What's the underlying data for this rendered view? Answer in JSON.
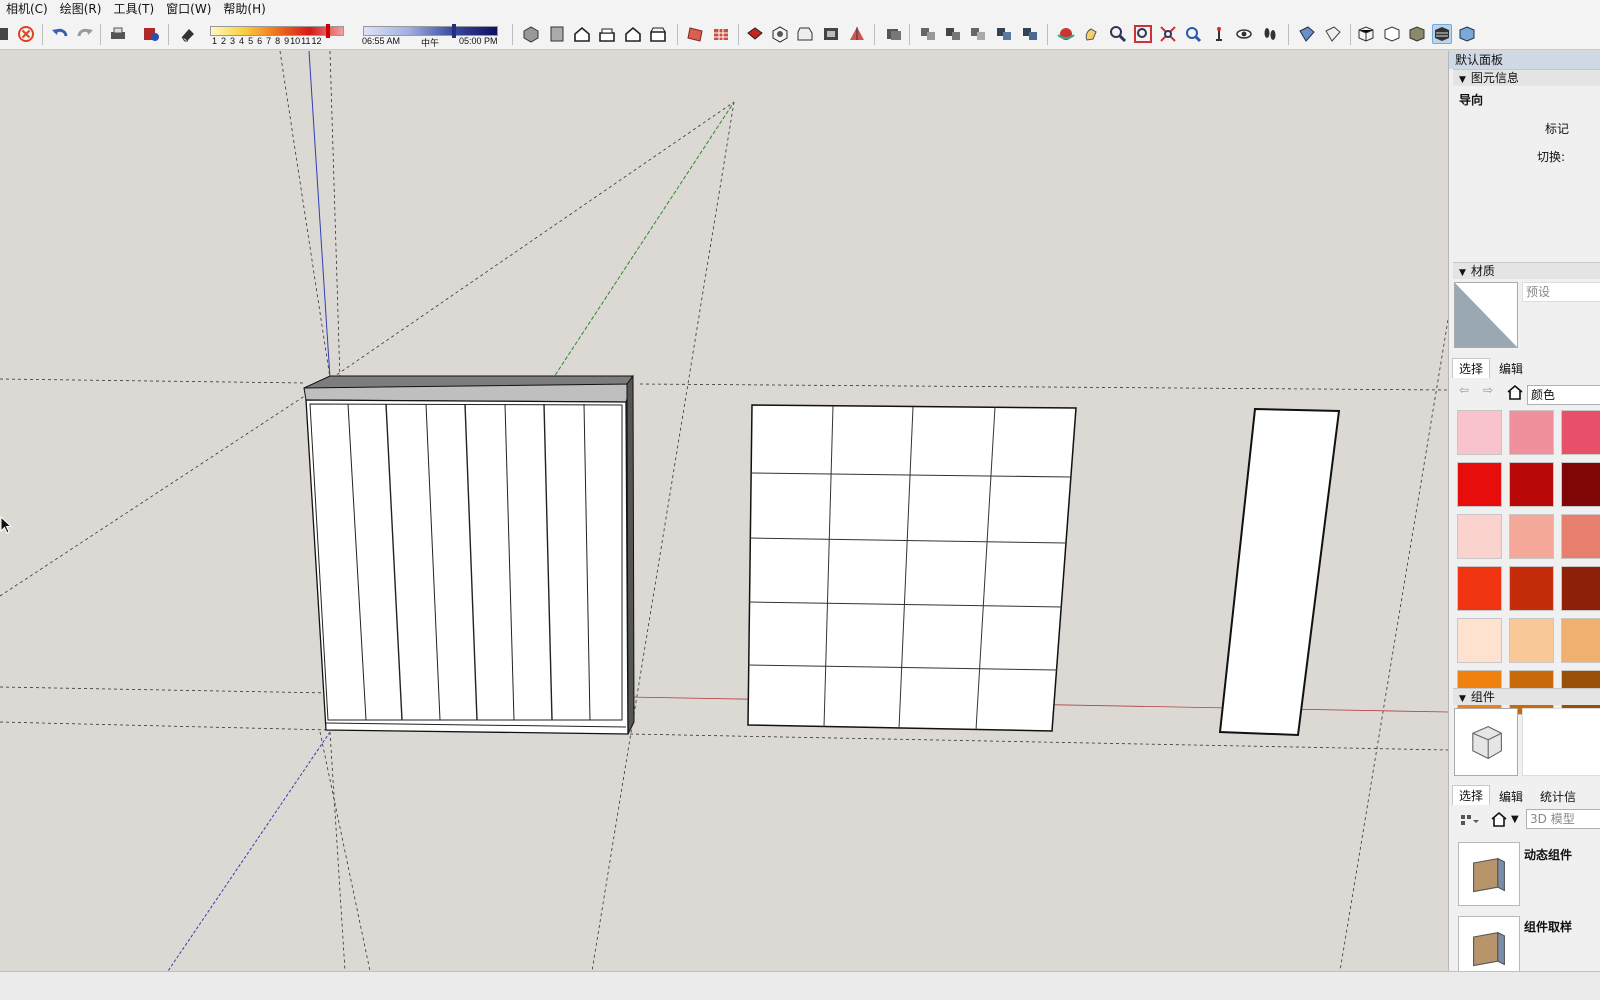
{
  "menu": [
    {
      "label": "相机(C)"
    },
    {
      "label": "绘图(R)"
    },
    {
      "label": "工具(T)"
    },
    {
      "label": "窗口(W)"
    },
    {
      "label": "帮助(H)"
    }
  ],
  "shadow": {
    "month_labels": [
      "1",
      "2",
      "3",
      "4",
      "5",
      "6",
      "7",
      "8",
      "9",
      "10",
      "11",
      "12"
    ],
    "time_start": "06:55 AM",
    "time_mid": "中午",
    "time_end": "05:00 PM"
  },
  "tray": {
    "title": "默认面板",
    "entity_info": {
      "header": "图元信息",
      "type": "导向",
      "tag_label": "标记",
      "toggle_label": "切换:"
    },
    "materials": {
      "header": "材质",
      "name_placeholder": "预设",
      "tab_select": "选择",
      "tab_edit": "编辑",
      "library": "颜色",
      "swatch_colors": [
        [
          "#f8c3cc",
          "#f0909e",
          "#e8506a"
        ],
        [
          "#e80d0d",
          "#b90808",
          "#7e0606"
        ],
        [
          "#fad3cf",
          "#f4a89a",
          "#e88070"
        ],
        [
          "#f03310",
          "#c42c0c",
          "#8e1f08"
        ],
        [
          "#fde3cf",
          "#f8c898",
          "#f0b070"
        ],
        [
          "#f08010",
          "#c86a0c",
          "#985008"
        ]
      ]
    },
    "components": {
      "header": "组件",
      "tab_select": "选择",
      "tab_edit": "编辑",
      "tab_stats": "统计信",
      "search_placeholder": "3D 模型",
      "items": [
        {
          "label": "动态组件"
        },
        {
          "label": "组件取样"
        }
      ]
    }
  },
  "colors": {
    "axis_red": "#b04040",
    "axis_green": "#2a8a2a",
    "axis_blue": "#3040b0",
    "tray_title_bg": "#cfd9e6",
    "viewport_bg": "#dcd9d5"
  }
}
